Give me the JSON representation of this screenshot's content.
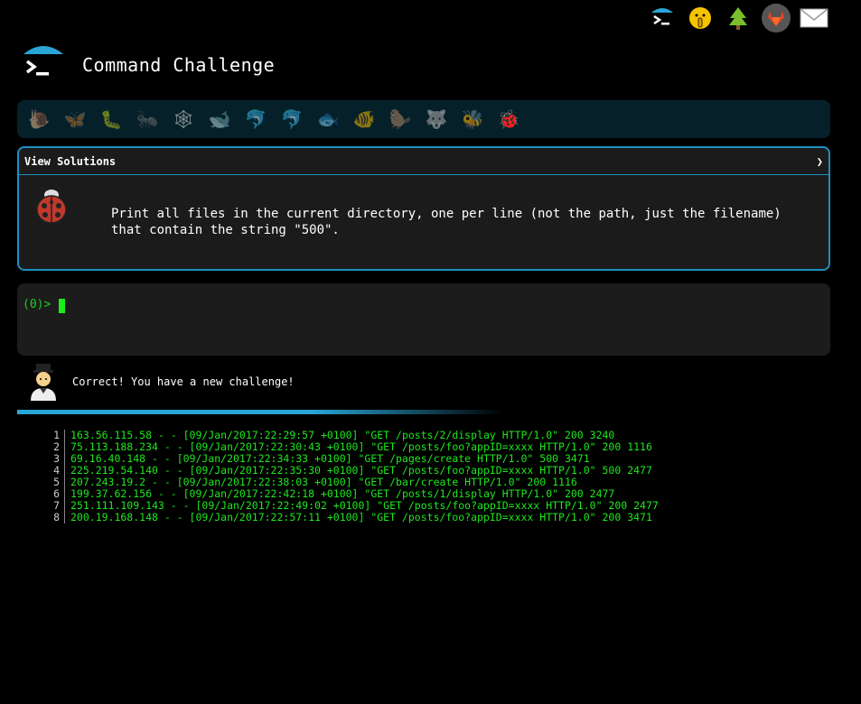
{
  "header": {
    "title": "Command Challenge",
    "top_icons": [
      "terminal-icon",
      "shushing-face-icon",
      "tree-icon",
      "gitlab-icon",
      "mail-icon"
    ]
  },
  "animals": [
    "snail",
    "butterfly",
    "caterpillar",
    "ant",
    "spider-web",
    "whale",
    "dolphin",
    "dolphin-2",
    "fish",
    "tropical-fish",
    "beaver",
    "wolf",
    "bee",
    "ladybug"
  ],
  "challenge": {
    "header_label": "View Solutions",
    "chevron": "❯",
    "text_line1": "Print all files in the current directory, one per line (not the path, just the filename)",
    "text_line2": "that contain the string \"500\"."
  },
  "terminal": {
    "prompt": "(0)>"
  },
  "result": {
    "message": "Correct! You have a new challenge!"
  },
  "output": [
    {
      "n": "1",
      "text": "163.56.115.58 - - [09/Jan/2017:22:29:57 +0100] \"GET /posts/2/display HTTP/1.0\" 200 3240"
    },
    {
      "n": "2",
      "text": "75.113.188.234 - - [09/Jan/2017:22:30:43 +0100] \"GET /posts/foo?appID=xxxx HTTP/1.0\" 200 1116"
    },
    {
      "n": "3",
      "text": "69.16.40.148 - - [09/Jan/2017:22:34:33 +0100] \"GET /pages/create HTTP/1.0\" 500 3471"
    },
    {
      "n": "4",
      "text": "225.219.54.140 - - [09/Jan/2017:22:35:30 +0100] \"GET /posts/foo?appID=xxxx HTTP/1.0\" 500 2477"
    },
    {
      "n": "5",
      "text": "207.243.19.2 - - [09/Jan/2017:22:38:03 +0100] \"GET /bar/create HTTP/1.0\" 200 1116"
    },
    {
      "n": "6",
      "text": "199.37.62.156 - - [09/Jan/2017:22:42:18 +0100] \"GET /posts/1/display HTTP/1.0\" 200 2477"
    },
    {
      "n": "7",
      "text": "251.111.109.143 - - [09/Jan/2017:22:49:02 +0100] \"GET /posts/foo?appID=xxxx HTTP/1.0\" 200 2477"
    },
    {
      "n": "8",
      "text": "200.19.168.148 - - [09/Jan/2017:22:57:11 +0100] \"GET /posts/foo?appID=xxxx HTTP/1.0\" 200 3471"
    }
  ]
}
